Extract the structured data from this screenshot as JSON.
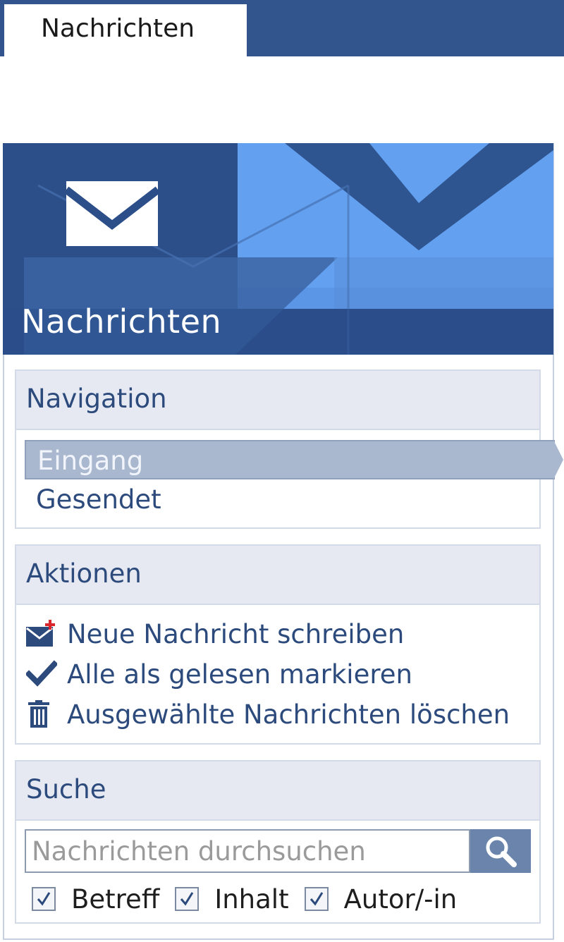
{
  "tabs": [
    {
      "label": "Nachrichten",
      "active": true
    }
  ],
  "banner": {
    "title": "Nachrichten",
    "icon": "envelope-icon"
  },
  "navigation": {
    "header": "Navigation",
    "items": [
      {
        "label": "Eingang",
        "selected": true
      },
      {
        "label": "Gesendet",
        "selected": false
      }
    ]
  },
  "actions": {
    "header": "Aktionen",
    "items": [
      {
        "label": "Neue Nachricht schreiben",
        "icon": "new-message-icon"
      },
      {
        "label": "Alle als gelesen markieren",
        "icon": "checkmark-icon"
      },
      {
        "label": "Ausgewählte Nachrichten löschen",
        "icon": "trash-icon"
      }
    ]
  },
  "search": {
    "header": "Suche",
    "placeholder": "Nachrichten durchsuchen",
    "button_icon": "search-icon",
    "filters": [
      {
        "label": "Betreff",
        "checked": true
      },
      {
        "label": "Inhalt",
        "checked": true
      },
      {
        "label": "Autor/-in",
        "checked": true
      }
    ]
  },
  "colors": {
    "primary": "#33558e",
    "selected": "#a9b7cf",
    "accent_red": "#d9262c"
  }
}
